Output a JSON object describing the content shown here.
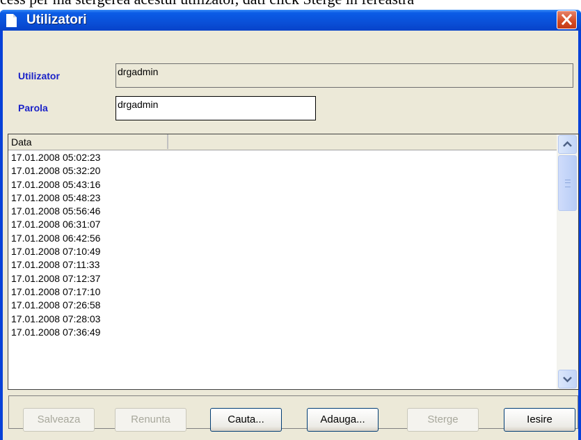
{
  "background_text": "cess per ma stergerea acestui utilizator, dati click Sterge in fereastra",
  "window": {
    "title": "Utilizatori"
  },
  "form": {
    "user_label": "Utilizator",
    "user_value": "drgadmin",
    "password_label": "Parola",
    "password_value": "drgadmin"
  },
  "list": {
    "column_header": "Data",
    "rows": [
      "17.01.2008 05:02:23",
      "17.01.2008 05:32:20",
      "17.01.2008 05:43:16",
      "17.01.2008 05:48:23",
      "17.01.2008 05:56:46",
      "17.01.2008 06:31:07",
      "17.01.2008 06:42:56",
      "17.01.2008 07:10:49",
      "17.01.2008 07:11:33",
      "17.01.2008 07:12:37",
      "17.01.2008 07:17:10",
      "17.01.2008 07:26:58",
      "17.01.2008 07:28:03",
      "17.01.2008 07:36:49"
    ]
  },
  "buttons": {
    "save": "Salveaza",
    "cancel": "Renunta",
    "search": "Cauta...",
    "add": "Adauga...",
    "delete": "Sterge",
    "exit": "Iesire"
  },
  "colors": {
    "title_bar": "#0a50d8",
    "label_blue": "#1a22c8",
    "close_red": "#d44a22",
    "dialog_face": "#ece9d8"
  },
  "icons": {
    "title": "document-icon",
    "close": "close-icon",
    "scroll_up": "chevron-up-icon",
    "scroll_down": "chevron-down-icon"
  }
}
